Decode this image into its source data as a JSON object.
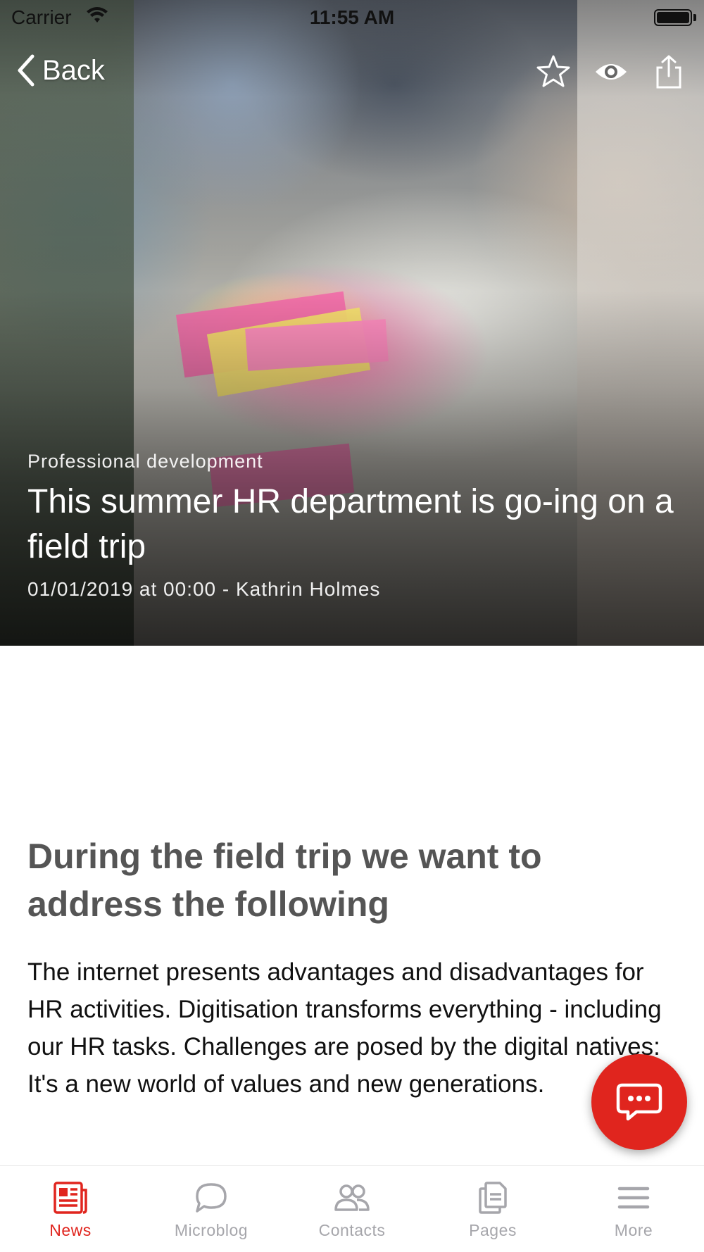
{
  "status_bar": {
    "carrier": "Carrier",
    "time": "11:55 AM"
  },
  "nav": {
    "back_label": "Back"
  },
  "hero": {
    "category": "Professional development",
    "title": "This summer HR department is go-ing on a field trip",
    "meta": "01/01/2019 at 00:00 -  Kathrin Holmes"
  },
  "article": {
    "heading": "During the field trip we want to address the following",
    "paragraph": "The internet presents advantages and disadvantages for HR activities. Digitisation transforms everything - including our HR tasks. Challenges are posed by the digital natives: It's a new world of values and new generations."
  },
  "tabbar": {
    "items": [
      {
        "label": "News",
        "icon": "news-icon",
        "active": true
      },
      {
        "label": "Microblog",
        "icon": "chat-bubble-icon",
        "active": false
      },
      {
        "label": "Contacts",
        "icon": "contacts-icon",
        "active": false
      },
      {
        "label": "Pages",
        "icon": "pages-icon",
        "active": false
      },
      {
        "label": "More",
        "icon": "menu-icon",
        "active": false
      }
    ]
  },
  "colors": {
    "accent": "#e0251e",
    "inactive": "#a6a6ab",
    "heading": "#555555"
  }
}
